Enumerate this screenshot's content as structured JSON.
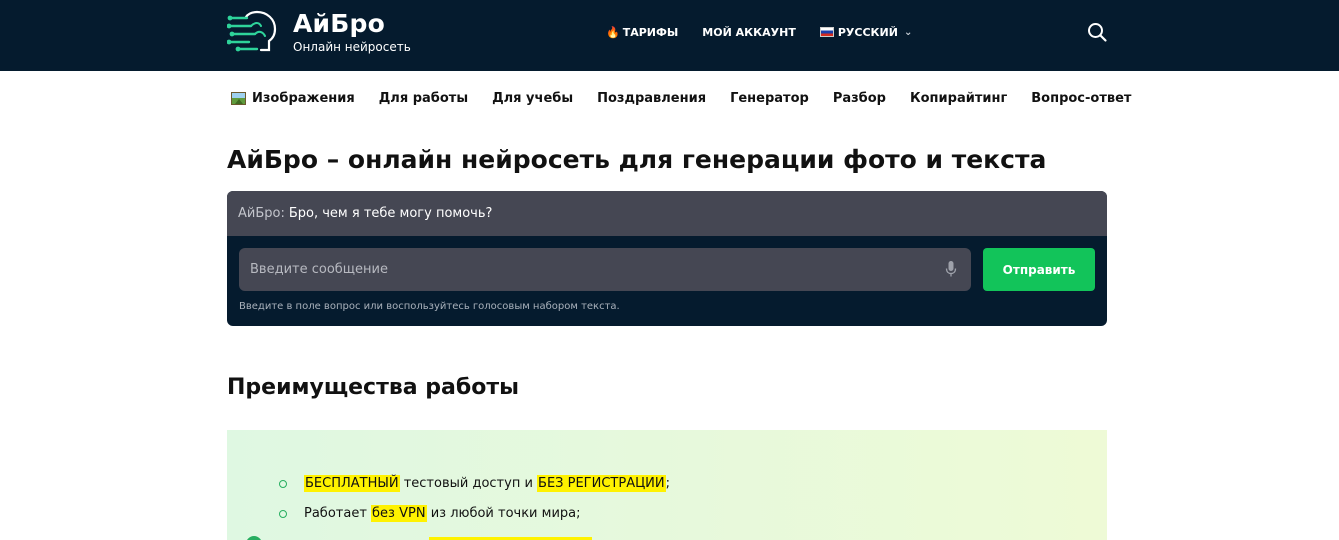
{
  "header": {
    "brand_name": "АйБро",
    "brand_subtitle": "Онлайн нейросеть",
    "nav": [
      {
        "label": "ТАРИФЫ",
        "icon": "fire-icon"
      },
      {
        "label": "МОЙ АККАУНТ"
      },
      {
        "label": "РУССКИЙ",
        "icon": "flag-icon"
      }
    ],
    "search_icon": "search-icon"
  },
  "categories": [
    {
      "label": "Изображения",
      "icon": "picture-icon"
    },
    {
      "label": "Для работы"
    },
    {
      "label": "Для учебы"
    },
    {
      "label": "Поздравления"
    },
    {
      "label": "Генератор"
    },
    {
      "label": "Разбор"
    },
    {
      "label": "Копирайтинг"
    },
    {
      "label": "Вопрос-ответ"
    }
  ],
  "main": {
    "title": "АйБро – онлайн нейросеть для генерации фото и текста"
  },
  "chat": {
    "sender": "АйБро:",
    "message": "Бро, чем я тебе могу помочь?",
    "input_placeholder": "Введите сообщение",
    "send_label": "Отправить",
    "hint": "Введите в поле вопрос или воспользуйтесь голосовым набором текста."
  },
  "advantages": {
    "title": "Преимущества работы",
    "items": [
      {
        "hl1": "БЕСПЛАТНЫЙ",
        "text1": " тестовый доступ и ",
        "hl2": "БЕЗ РЕГИСТРАЦИИ",
        "text2": ";"
      },
      {
        "text0": "Работает ",
        "hl1": "без VPN",
        "text1": " из любой точки мира;"
      }
    ]
  },
  "colors": {
    "header_bg": "#051b2e",
    "accent_green": "#12c45a",
    "highlight": "#fff200"
  }
}
